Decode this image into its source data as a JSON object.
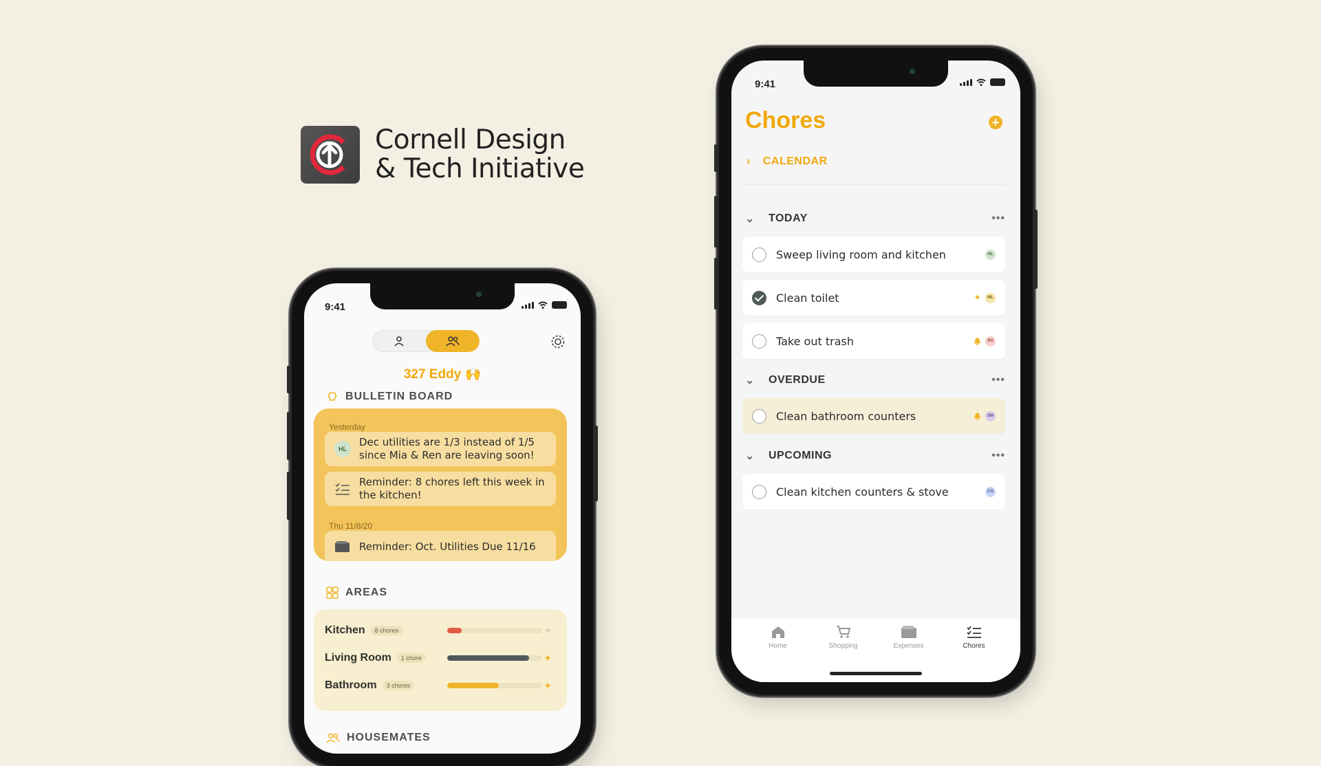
{
  "colors": {
    "accent": "#f0b429",
    "background": "#f3f0e3",
    "bulletin": "#f2c45a"
  },
  "logo": {
    "line1": "Cornell Design",
    "line2": "& Tech Initiative"
  },
  "left_phone": {
    "time": "9:41",
    "segments": [
      {
        "icon": "person-icon"
      },
      {
        "icon": "group-icon",
        "active": true
      }
    ],
    "house_name": "327 Eddy 🙌",
    "bulletin": {
      "header": "BULLETIN BOARD",
      "groups": [
        {
          "date": "Yesterday",
          "items": [
            {
              "avatar": "HL",
              "text": "Dec utilities are 1/3 instead of 1/5 since Mia & Ren are leaving soon!"
            },
            {
              "icon": "checklist-icon",
              "text": "Reminder: 8 chores left this week in the kitchen!"
            }
          ]
        },
        {
          "date": "Thu 11/8/20",
          "items": [
            {
              "icon": "wallet-icon",
              "text": "Reminder: Oct. Utilities Due 11/16"
            }
          ]
        }
      ]
    },
    "areas": {
      "header": "AREAS",
      "items": [
        {
          "name": "Kitchen",
          "badge": "8 chores",
          "progress": 0.15,
          "color": "#e15b45"
        },
        {
          "name": "Living Room",
          "badge": "1 chore",
          "progress": 0.86,
          "color": "#4e5a58"
        },
        {
          "name": "Bathroom",
          "badge": "3 chores",
          "progress": 0.54,
          "color": "#f0b429"
        }
      ]
    },
    "housemates": {
      "header": "HOUSEMATES"
    }
  },
  "right_phone": {
    "time": "9:41",
    "title": "Chores",
    "calendar_label": "CALENDAR",
    "groups": [
      {
        "label": "TODAY",
        "tasks": [
          {
            "text": "Sweep living room and kitchen",
            "done": false,
            "assignee": "HL"
          },
          {
            "text": "Clean toilet",
            "done": true,
            "assignee": "ML",
            "flag": "sparkle"
          },
          {
            "text": "Take out trash",
            "done": false,
            "assignee": "RS",
            "flag": "bell"
          }
        ]
      },
      {
        "label": "OVERDUE",
        "tasks": [
          {
            "text": "Clean bathroom counters",
            "done": false,
            "assignee": "SM",
            "flag": "bell"
          }
        ]
      },
      {
        "label": "UPCOMING",
        "tasks": [
          {
            "text": "Clean kitchen counters & stove",
            "done": false,
            "assignee": "CG"
          }
        ]
      }
    ],
    "tabs": [
      {
        "label": "Home",
        "icon": "home-icon"
      },
      {
        "label": "Shopping",
        "icon": "cart-icon"
      },
      {
        "label": "Expenses",
        "icon": "wallet-icon"
      },
      {
        "label": "Chores",
        "icon": "checklist-icon",
        "active": true
      }
    ]
  }
}
